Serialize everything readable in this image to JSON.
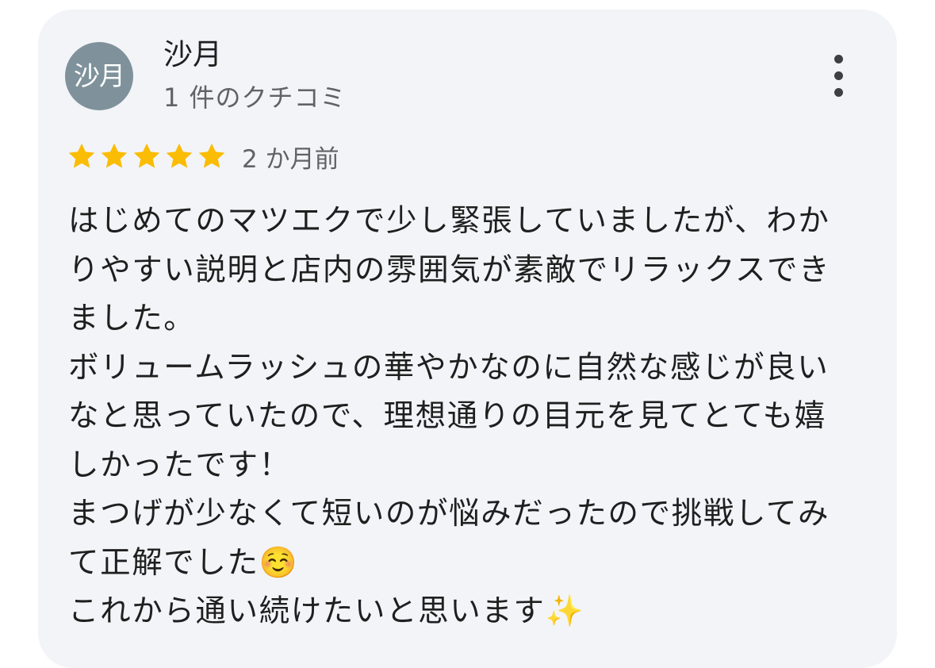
{
  "review": {
    "avatar_text": "沙月",
    "reviewer_name": "沙月",
    "review_count": "1 件のクチコミ",
    "rating": 5,
    "rating_max": 5,
    "date": "2 か月前",
    "star_color": "#fbbc04",
    "more_icon": "more-vert-icon",
    "body_lines": [
      "はじめてのマツエクで少し緊張していましたが、わか",
      "りやすい説明と店内の雰囲気が素敵でリラックスでき",
      "ました。",
      "ボリュームラッシュの華やかなのに自然な感じが良い",
      "なと思っていたので、理想通りの目元を見てとても嬉",
      "しかったです！",
      "まつげが少なくて短いのが悩みだったので挑戦してみ",
      "て正解でした☺️",
      "これから通い続けたいと思います✨"
    ]
  }
}
